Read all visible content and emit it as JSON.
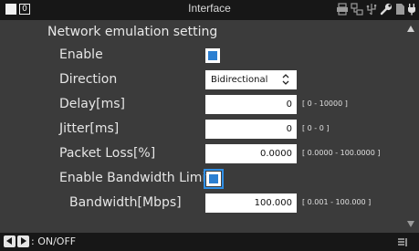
{
  "status": {
    "badge": "0",
    "title": "Interface",
    "icons": [
      "printer-icon",
      "network-icon",
      "usb-icon",
      "wrench-icon",
      "sd-card-icon",
      "plug-icon"
    ]
  },
  "page": {
    "heading": "Network emulation setting"
  },
  "settings": {
    "enable_label": "Enable",
    "enable_checked": true,
    "direction_label": "Direction",
    "direction_value": "Bidirectional",
    "delay_label": "Delay[ms]",
    "delay_value": "0",
    "delay_range": "[ 0 - 10000 ]",
    "jitter_label": "Jitter[ms]",
    "jitter_value": "0",
    "jitter_range": "[ 0 - 0 ]",
    "loss_label": "Packet Loss[%]",
    "loss_value": "0.0000",
    "loss_range": "[ 0.0000  -  100.0000 ]",
    "bw_limit_label": "Enable Bandwidth Limit",
    "bw_limit_checked": true,
    "bandwidth_label": "Bandwidth[Mbps]",
    "bandwidth_value": "100.000",
    "bandwidth_range": "[ 0.001  -  100.000 ]"
  },
  "footer": {
    "hint": ": ON/OFF"
  },
  "colors": {
    "accent": "#2c7fd1",
    "background": "#3b3b3b",
    "bar": "#171717"
  }
}
